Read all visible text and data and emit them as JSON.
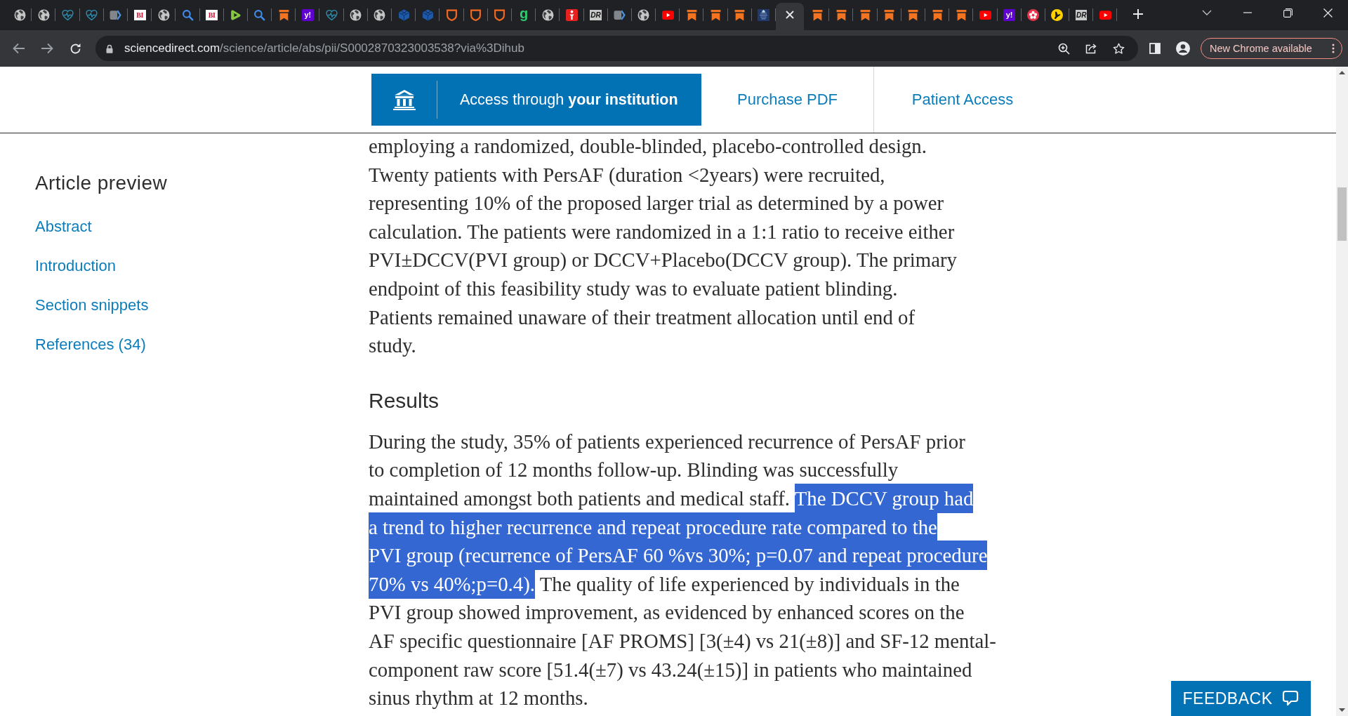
{
  "browser": {
    "tabs": [
      {
        "kind": "globe",
        "selected": false
      },
      {
        "kind": "globe",
        "selected": false
      },
      {
        "kind": "heart",
        "selected": false
      },
      {
        "kind": "heart",
        "selected": false
      },
      {
        "kind": "chevron",
        "selected": false
      },
      {
        "kind": "bi",
        "text": "BI",
        "selected": false
      },
      {
        "kind": "globe",
        "selected": false
      },
      {
        "kind": "search",
        "selected": false
      },
      {
        "kind": "bi",
        "text": "BI",
        "selected": false
      },
      {
        "kind": "play",
        "selected": false
      },
      {
        "kind": "search",
        "selected": false
      },
      {
        "kind": "bookmark",
        "selected": false
      },
      {
        "kind": "yahoo",
        "text": "y!",
        "selected": false
      },
      {
        "kind": "heart",
        "selected": false
      },
      {
        "kind": "globe",
        "selected": false
      },
      {
        "kind": "globe",
        "selected": false
      },
      {
        "kind": "cube",
        "selected": false
      },
      {
        "kind": "cube",
        "selected": false
      },
      {
        "kind": "shield",
        "selected": false
      },
      {
        "kind": "shield",
        "selected": false
      },
      {
        "kind": "shield",
        "selected": false
      },
      {
        "kind": "g",
        "text": "g",
        "selected": false
      },
      {
        "kind": "globe",
        "selected": false
      },
      {
        "kind": "figure",
        "selected": false
      },
      {
        "kind": "dr",
        "text": "DR",
        "selected": false
      },
      {
        "kind": "chevron",
        "selected": false
      },
      {
        "kind": "globe",
        "selected": false
      },
      {
        "kind": "youtube",
        "selected": false
      },
      {
        "kind": "bookmark",
        "selected": false
      },
      {
        "kind": "bookmark",
        "selected": false
      },
      {
        "kind": "bookmark",
        "selected": false
      },
      {
        "kind": "crest",
        "selected": false
      },
      {
        "selected": true
      },
      {
        "kind": "bookmark",
        "selected": false
      },
      {
        "kind": "bookmark",
        "selected": false
      },
      {
        "kind": "bookmark",
        "selected": false
      },
      {
        "kind": "bookmark",
        "selected": false
      },
      {
        "kind": "bookmark",
        "selected": false
      },
      {
        "kind": "bookmark",
        "selected": false
      },
      {
        "kind": "bookmark",
        "selected": false
      },
      {
        "kind": "youtube",
        "selected": false
      },
      {
        "kind": "yahoo",
        "text": "y!",
        "selected": false
      },
      {
        "kind": "yelp",
        "selected": false
      },
      {
        "kind": "pages",
        "selected": false
      },
      {
        "kind": "dr",
        "text": "DR",
        "selected": false
      },
      {
        "kind": "youtube",
        "selected": false
      }
    ],
    "url_host": "sciencedirect.com",
    "url_path": "/science/article/abs/pii/S0002870323003538?via%3Dihub",
    "update_button": "New Chrome available"
  },
  "header": {
    "access_button": "Access through **your institution**",
    "links": [
      "Purchase PDF",
      "Patient Access"
    ]
  },
  "sidebar": {
    "title": "Article preview",
    "items": [
      "Abstract",
      "Introduction",
      "Section snippets",
      "References (34)"
    ]
  },
  "article": {
    "blocks": [
      {
        "kind": "paragraph",
        "lines": [
          [
            {
              "text": "employing a randomized, double-blinded, placebo-controlled design.",
              "selected": false
            }
          ],
          [
            {
              "text": "Twenty patients with PersAF (duration <2years) were recruited,",
              "selected": false
            }
          ],
          [
            {
              "text": "representing 10% of the proposed larger trial as determined by a power",
              "selected": false
            }
          ],
          [
            {
              "text": "calculation. The patients were randomized in a 1:1 ratio to receive either",
              "selected": false
            }
          ],
          [
            {
              "text": "PVI±DCCV(PVI group) or DCCV+Placebo(DCCV group). The primary",
              "selected": false
            }
          ],
          [
            {
              "text": "endpoint of this feasibility study was to evaluate patient blinding.",
              "selected": false
            }
          ],
          [
            {
              "text": "Patients remained unaware of their treatment allocation until end of",
              "selected": false
            }
          ],
          [
            {
              "text": "study.",
              "selected": false
            }
          ]
        ]
      },
      {
        "kind": "heading",
        "text": "Results"
      },
      {
        "kind": "paragraph",
        "lines": [
          [
            {
              "text": "During the study, 35% of patients experienced recurrence of PersAF prior",
              "selected": false
            }
          ],
          [
            {
              "text": "to completion of 12 months follow-up. Blinding was successfully",
              "selected": false
            }
          ],
          [
            {
              "text": "maintained amongst both patients and medical staff. ",
              "selected": false
            },
            {
              "text": "The DCCV group had",
              "selected": true
            }
          ],
          [
            {
              "text": "a trend to higher recurrence and repeat procedure rate compared to the",
              "selected": true
            }
          ],
          [
            {
              "text": "PVI group (recurrence of PersAF 60 %vs 30%; p=0.07 and repeat procedure",
              "selected": true
            }
          ],
          [
            {
              "text": "70% vs 40%;p=0.4).",
              "selected": true
            },
            {
              "text": " The quality of life experienced by individuals in the",
              "selected": false
            }
          ],
          [
            {
              "text": "PVI group showed improvement, as evidenced by enhanced scores on the",
              "selected": false
            }
          ],
          [
            {
              "text": "AF specific questionnaire [AF PROMS] [3(±4) vs 21(±8)] and SF-12 mental-",
              "selected": false
            }
          ],
          [
            {
              "text": "component raw score [51.4(±7) vs 43.24(±15)] in patients who maintained",
              "selected": false
            }
          ],
          [
            {
              "text": "sinus rhythm at 12 months.",
              "selected": false
            }
          ]
        ]
      }
    ]
  },
  "feedback_button": "FEEDBACK"
}
